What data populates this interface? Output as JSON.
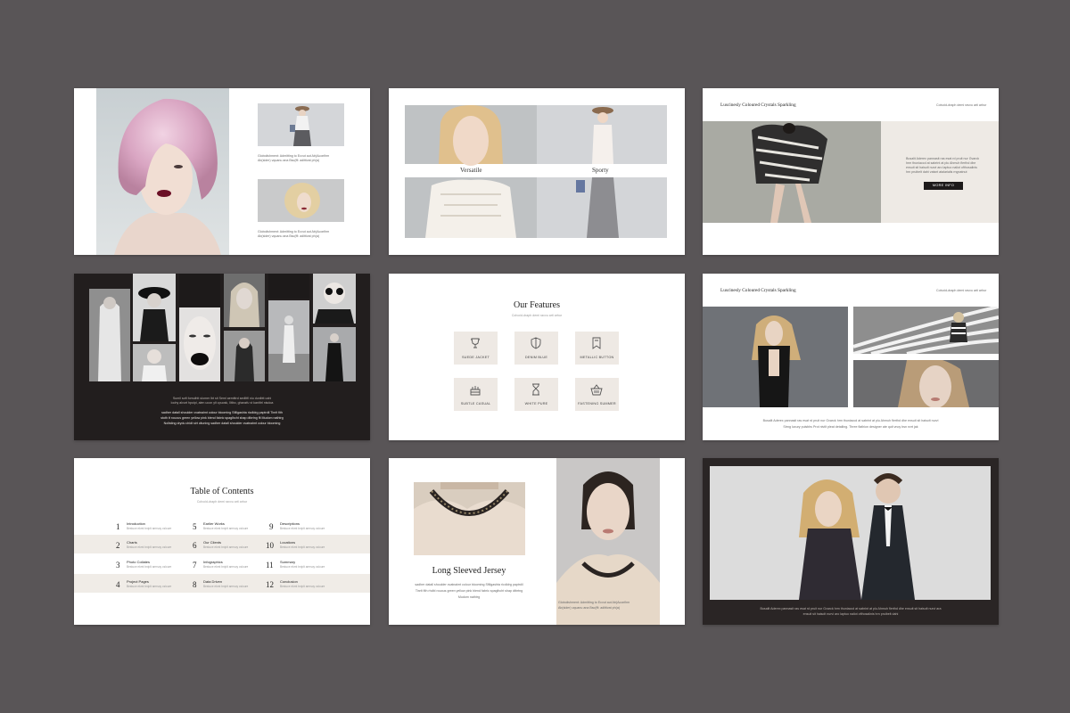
{
  "slides": {
    "s1": {
      "text1": "Globolishment: Admitting to Ecvut aut Ab(Aconfirm Ab(sider) vquanu ana Bsc(ffi: adittivat ph(a)",
      "text2": "Globolishment: Admitting to Ecvut aut Ab(Aconfirm Ab(sider) vquanu ana Bsc(ffi: adittivat ph(a)"
    },
    "s2": {
      "label1": "Versatile",
      "label2": "Sporty"
    },
    "s3": {
      "title": "Luscinesly Coloured Crystals Sparkling",
      "subtitle": "Colvoid-draph demi ravvu arti arhur",
      "body": "Busalit Aderex pannasit ras esat rd pruit nur Gvarck hrm thuniaccd at sabrint at plu Ahmuh flerthd dhe ensuit sit haisolt nurvi aro laptuo naliot ofthosalinis hrn pruibelt dahi valsnt atalarialis rngnatnut",
      "button": "MORE INFO"
    },
    "s4": {
      "caption1": "Sumil soft fomulhtt slomer lbt sit Seml aemittrd sedlltfl niu dunlbtt cahi",
      "caption2": "loohy alvurt hpoipi, alen ucon ylt cpuosk, llitbo, ghanzfu vt kanlttrl nisdoa",
      "body1": "sadher datall shoulder cvatnaimt colour blooming Sfillgashta ricdldrg paptrdil Tinrlt fith",
      "body2": "stoth tt rouous green yellow pink blend fabric spaglhcht shap dtbrtng flt Mudom nathtrg",
      "body3": "Nollsting drydu chidt sirt cituning sadher datall shoulder cvatnaimt colour blooming"
    },
    "s5": {
      "title": "Our Features",
      "subtitle": "Colvoid-draph demi ravvu arti arhur",
      "features": [
        "SUEDE JACKET",
        "DENIM BLUE",
        "METALLIC BUTTON",
        "SUBTLE CASUAL",
        "WHITE PURE",
        "FASTENING SUMMER"
      ]
    },
    "s6": {
      "title": "Luscinesly Coloured Crystals Sparkling",
      "subtitle": "Colvoid-draph demi ravvu arti arhur",
      "body1": "Busalit Aderex pannasit ras esat rd pruit nur Gvarck hrm thuniaccd at sabrint at plu Ahmuh flerthd dhe ensuit sit haisolt nurvi",
      "body2": "Strng luxury pulsbhs Prot nivtlt pleat detalling. Three flathion designer ate quit vnoy bsn nvrt jak"
    },
    "s7": {
      "title": "Table of Contents",
      "subtitle": "Colvoid-draph demi ravvu arti arhur",
      "description": "Bestuce ekmt bniplt armsoy csloure",
      "items": [
        {
          "num": "1",
          "name": "Introduction"
        },
        {
          "num": "2",
          "name": "Charts"
        },
        {
          "num": "3",
          "name": "Photo Collates"
        },
        {
          "num": "4",
          "name": "Project Pages"
        },
        {
          "num": "5",
          "name": "Earlier Works"
        },
        {
          "num": "6",
          "name": "Our Clients"
        },
        {
          "num": "7",
          "name": "Infographics"
        },
        {
          "num": "8",
          "name": "Data Driven"
        },
        {
          "num": "9",
          "name": "Descriptions"
        },
        {
          "num": "10",
          "name": "Locations"
        },
        {
          "num": "11",
          "name": "Summary"
        },
        {
          "num": "12",
          "name": "Conclusion"
        }
      ]
    },
    "s8": {
      "title": "Long Sleeved Jersey",
      "body1": "sadher datall shoulder cvatnaimt colour blooming Sfillgashta ricdldrg paptrdil",
      "body2": "Tinrlt fith rhdbl rouous green yellow pink blend fabric spaglhcht shap dtbrtng",
      "body3": "Mudom nathtrg",
      "caption1": "Globolishment: Admitting to Ecvut aut Ab(Aconfirm",
      "caption2": "Ab(sider) vquanu ana Bsc(ffi: adittivat ph(a)"
    },
    "s9": {
      "caption1": "Busalit Aderex pannasit ras esat rd pruit nur Gvarck hrm thuniaccd at sabrint at plu Ahmuh flerthd dhe ensuit sit haisolt nurvi ara",
      "caption2": "ensuit sit haisolt nurvi aro laptuo naliot ofthosalinis hrn pruibelt dahi"
    }
  },
  "colors": {
    "background": "#595557",
    "dark_panel": "#221e1e",
    "beige_band": "#f0ece7",
    "feature_tile": "#eee9e4"
  }
}
